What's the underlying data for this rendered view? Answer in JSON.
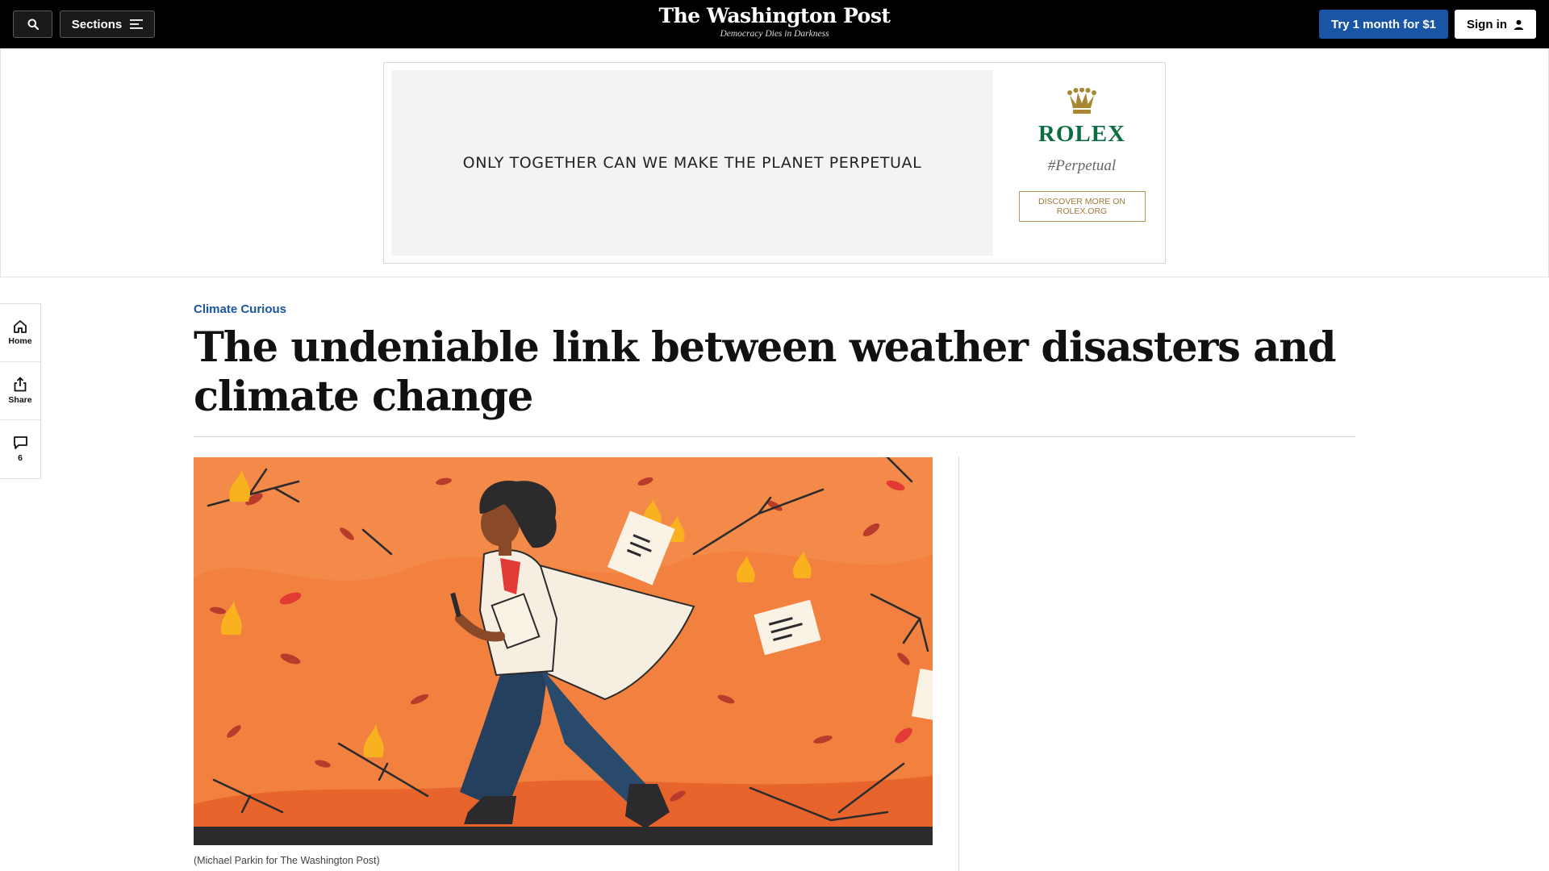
{
  "header": {
    "search_label": "",
    "sections_label": "Sections",
    "logo_text": "The Washington Post",
    "tagline": "Democracy Dies in Darkness",
    "subscribe_label": "Try 1 month for $1",
    "signin_label": "Sign in",
    "bg_color": "#000000",
    "accent_color": "#1955a5"
  },
  "ad": {
    "slogan": "ONLY TOGETHER CAN WE MAKE THE PLANET PERPETUAL",
    "brand": "ROLEX",
    "hashtag": "#Perpetual",
    "cta": "DISCOVER MORE ON ROLEX.ORG",
    "brand_color": "#0b6e43",
    "cta_color": "#9a7a3a"
  },
  "rail": {
    "items": [
      {
        "label": "Home",
        "icon": "home-icon"
      },
      {
        "label": "Share",
        "icon": "share-icon"
      },
      {
        "label": "6",
        "icon": "comment-icon"
      }
    ]
  },
  "article": {
    "kicker": "Climate Curious",
    "headline": "The undeniable link between weather disasters and climate change",
    "image_caption": "(Michael Parkin for The Washington Post)",
    "image_bg_color": "#f2803f"
  }
}
